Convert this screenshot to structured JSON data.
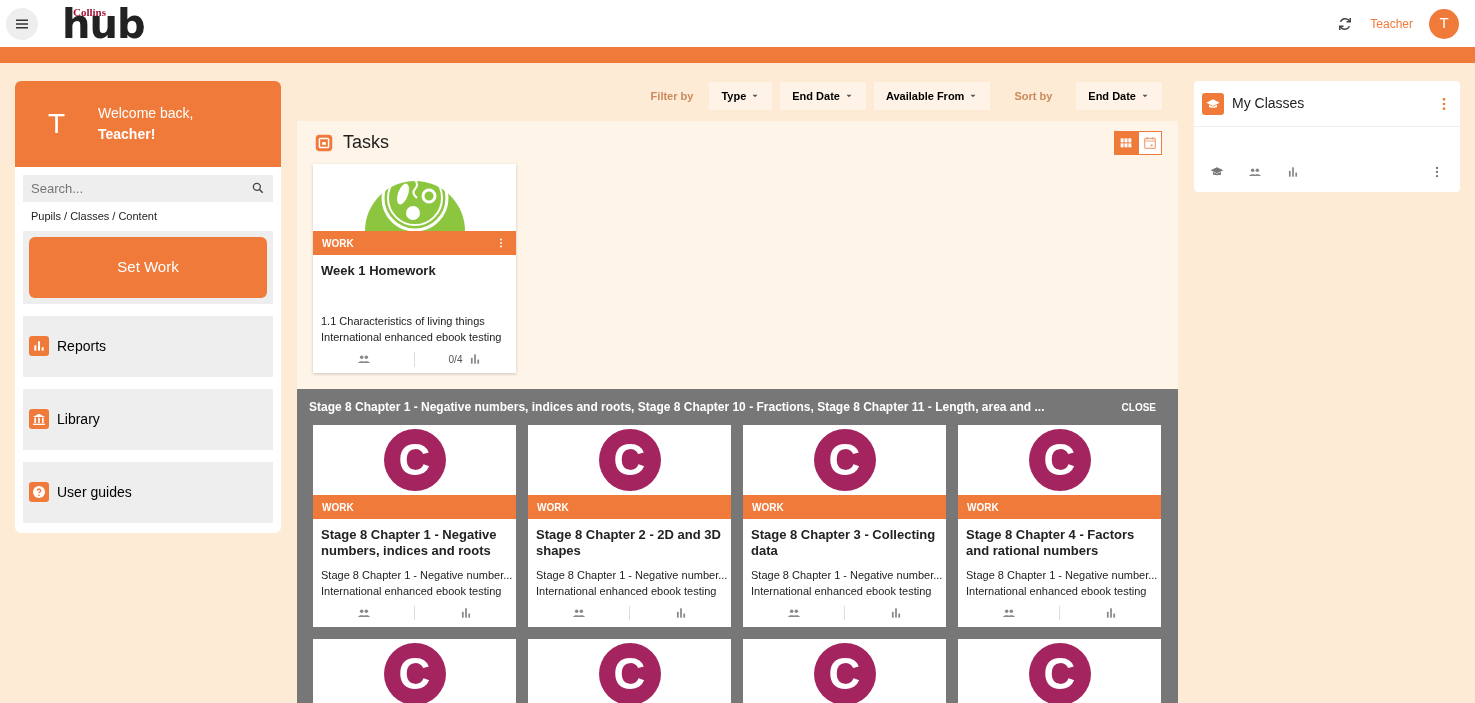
{
  "header": {
    "logo_small": "Collins",
    "logo_big": "hub",
    "user_name": "Teacher",
    "avatar_letter": "T"
  },
  "welcome": {
    "avatar_letter": "T",
    "greeting": "Welcome back,",
    "name": "Teacher!"
  },
  "search": {
    "placeholder": "Search...",
    "hint": "Pupils / Classes / Content"
  },
  "set_work": "Set Work",
  "nav_items": [
    {
      "label": "Reports",
      "kind": "reports"
    },
    {
      "label": "Library",
      "kind": "library"
    },
    {
      "label": "User guides",
      "kind": "guides"
    }
  ],
  "filters": {
    "filter_label": "Filter by",
    "filter_buttons": [
      "Type",
      "End Date",
      "Available From"
    ],
    "sort_label": "Sort by",
    "sort_button": "End Date"
  },
  "tasks": {
    "title": "Tasks",
    "views": [
      {
        "kind": "grid",
        "selected": true
      },
      {
        "kind": "calendar",
        "selected": false
      }
    ],
    "cards": [
      {
        "tag": "WORK",
        "title": "Week 1 Homework",
        "line1": "1.1 Characteristics of living things",
        "line2": "International enhanced ebook testing",
        "progress": "0/4"
      }
    ]
  },
  "group": {
    "title": "Stage 8 Chapter 1 - Negative numbers, indices and roots, Stage 8 Chapter 10 - Fractions, Stage 8 Chapter 11 - Length, area and ...",
    "close": "CLOSE",
    "cards": [
      {
        "logo": "C",
        "tag": "WORK",
        "title": "Stage 8 Chapter 1 - Negative numbers, indices and roots",
        "line1": "Stage 8 Chapter 1 - Negative number...",
        "line2": "International enhanced ebook testing"
      },
      {
        "logo": "C",
        "tag": "WORK",
        "title": "Stage 8 Chapter 2 - 2D and 3D shapes",
        "line1": "Stage 8 Chapter 1 - Negative number...",
        "line2": "International enhanced ebook testing"
      },
      {
        "logo": "C",
        "tag": "WORK",
        "title": "Stage 8 Chapter 3 - Collecting data",
        "line1": "Stage 8 Chapter 1 - Negative number...",
        "line2": "International enhanced ebook testing"
      },
      {
        "logo": "C",
        "tag": "WORK",
        "title": "Stage 8 Chapter 4 - Factors and rational numbers",
        "line1": "Stage 8 Chapter 1 - Negative number...",
        "line2": "International enhanced ebook testing"
      },
      {
        "logo": "C"
      },
      {
        "logo": "C"
      },
      {
        "logo": "C"
      },
      {
        "logo": "C"
      }
    ]
  },
  "my_classes": {
    "title": "My Classes"
  }
}
